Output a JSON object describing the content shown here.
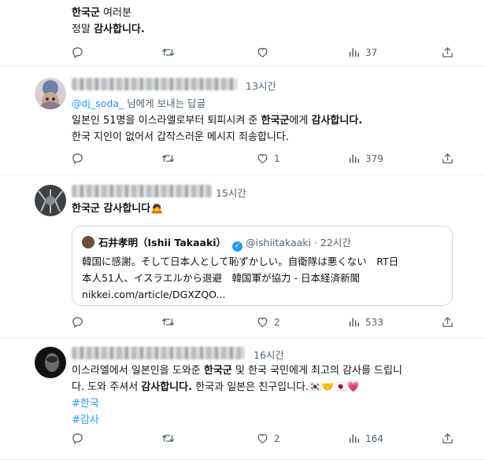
{
  "tweets": [
    {
      "lines": [
        [
          "한국군",
          " 여러분"
        ],
        [
          "정말 ",
          "감사합니다."
        ]
      ],
      "actions": {
        "reply": "",
        "retweet": "",
        "like": "",
        "views": "37"
      }
    },
    {
      "time": "13시간",
      "reply_prefix": "@dj_soda_",
      "reply_suffix": " 님에게 보내는 답글",
      "line1": [
        "일본인 51명을 이스라엘로부터 퇴피시켜 준 ",
        "한국군",
        "에게 ",
        "감사합니다."
      ],
      "line2": "한국 지인이 없어서 갑작스러운 메시지 죄송합니다.",
      "actions": {
        "reply": "",
        "retweet": "",
        "like": "1",
        "views": "379"
      }
    },
    {
      "time": "15시간",
      "text": "한국군 감사합니다",
      "emoji": "🙇",
      "quote": {
        "name": "石井孝明（Ishii Takaaki）",
        "handle": "@ishiitakaaki · 22시간",
        "line1": "韓国に感謝。そして日本人として恥ずかしい。自衛隊は悪くない　RT日",
        "line2": "本人51人、イスラエルから退避　韓国軍が協力 - 日本経済新聞",
        "line3": "nikkei.com/article/DGXZQO..."
      },
      "actions": {
        "reply": "",
        "retweet": "",
        "like": "2",
        "views": "533"
      }
    },
    {
      "time": "16시간",
      "line1": [
        "이스라엘에서 일본인을 도와준 ",
        "한국군",
        " 및 한국 국민에게 최고의 감사를 드립니"
      ],
      "line2": [
        "다. 도와 주셔서 ",
        "감사합니다.",
        " 한국과 일본은 친구입니다."
      ],
      "line2_emoji": "🇰🇷🤝🇯🇵💗",
      "hashtags": [
        "#한국",
        "#감사"
      ],
      "actions": {
        "reply": "",
        "retweet": "",
        "like": "2",
        "views": "164"
      }
    }
  ],
  "colors": {
    "accent": "#1d9bf0",
    "secondary_text": "#536471",
    "border": "#eff3f4"
  },
  "icons": [
    "reply-icon",
    "retweet-icon",
    "like-icon",
    "views-icon",
    "share-icon"
  ]
}
